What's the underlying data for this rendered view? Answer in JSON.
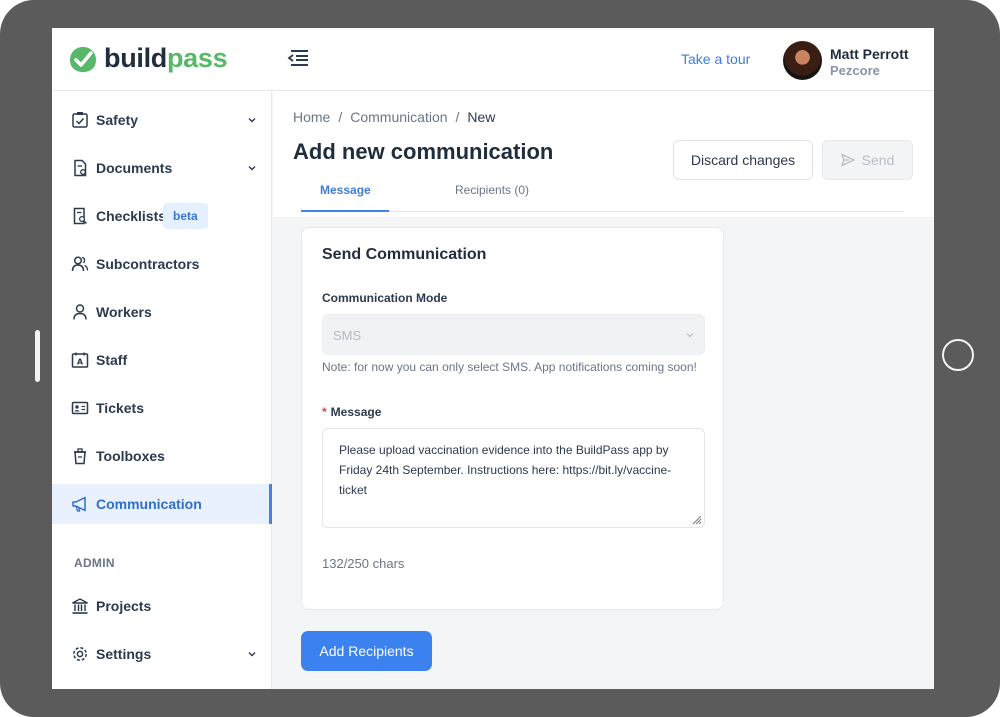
{
  "app": {
    "logo_text_1": "build",
    "logo_text_2": "pass"
  },
  "header": {
    "take_tour": "Take a tour",
    "user_name": "Matt Perrott",
    "user_org": "Pezcore"
  },
  "sidebar": {
    "items": [
      {
        "label": "Safety",
        "icon": "checkbox-clipboard-icon",
        "has_chevron": true
      },
      {
        "label": "Documents",
        "icon": "document-icon",
        "has_chevron": true
      },
      {
        "label": "Checklists",
        "icon": "checklist-icon",
        "badge": "beta"
      },
      {
        "label": "Subcontractors",
        "icon": "users-icon"
      },
      {
        "label": "Workers",
        "icon": "user-icon"
      },
      {
        "label": "Staff",
        "icon": "id-card-icon"
      },
      {
        "label": "Tickets",
        "icon": "ticket-icon"
      },
      {
        "label": "Toolboxes",
        "icon": "toolbox-icon"
      },
      {
        "label": "Communication",
        "icon": "megaphone-icon",
        "active": true
      }
    ],
    "section_admin": "ADMIN",
    "admin_items": [
      {
        "label": "Projects",
        "icon": "building-icon"
      },
      {
        "label": "Settings",
        "icon": "gear-icon",
        "has_chevron": true
      }
    ]
  },
  "breadcrumb": {
    "home": "Home",
    "section": "Communication",
    "current": "New",
    "separator": "/"
  },
  "page": {
    "title": "Add new communication",
    "discard_label": "Discard changes",
    "send_label": "Send"
  },
  "tabs": {
    "message": "Message",
    "recipients": "Recipients (0)"
  },
  "form": {
    "card_title": "Send Communication",
    "mode_label": "Communication Mode",
    "mode_value": "SMS",
    "note": "Note: for now you can only select SMS. App notifications coming soon!",
    "required_mark": "*",
    "message_label": "Message",
    "message_value": "Please upload vaccination evidence into the BuildPass app by Friday 24th September. Instructions here: https://bit.ly/vaccine-ticket",
    "char_count": "132/250 chars",
    "add_recipients": "Add Recipients"
  },
  "colors": {
    "accent": "#3b82f0",
    "brand_green": "#57b86a",
    "active_bg": "#e8f1fd"
  }
}
